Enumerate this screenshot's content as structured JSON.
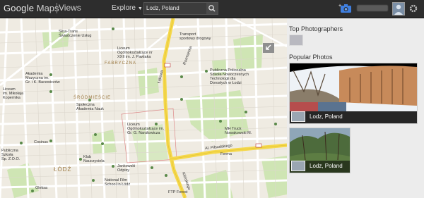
{
  "header": {
    "logo_google": "Google",
    "logo_maps": "Maps",
    "views": "Views",
    "explore": "Explore",
    "search_value": "Lodz, Poland"
  },
  "panel": {
    "top_photographers": "Top Photographers",
    "popular_photos": "Popular Photos",
    "photos": [
      {
        "caption": "Lodz, Poland"
      },
      {
        "caption": "Lodz, Poland"
      }
    ]
  },
  "map": {
    "labels": [
      "Skra-Trans",
      "Świadczenie Usług",
      "Transport",
      "sportowy drogowy",
      "Liceum",
      "Ogólnokształcące nr",
      "XXII im. J. Pawlaka",
      "Akademia",
      "Muzyczna im.",
      "Gr. i K. Bacewiczów",
      "Liceum",
      "im. Mikołaja",
      "Kopernika",
      "ŚRÓDMIEŚCIE",
      "Społeczna",
      "Akademia Nauk",
      "Publiczna Policealna",
      "Szkoła Nowoczesnych",
      "Technologii dla",
      "Dorosłych w Łodzi",
      "Liceum",
      "Ogólnokształcące im.",
      "Gr. G. Narutowicza",
      "MH Truck",
      "Nowakowski M.",
      "Cosinus",
      "Klub",
      "Nauczyciela",
      "Jankowski",
      "Odpisy",
      "National Film",
      "School in Łódź",
      "ŁÓDŹ",
      "FABRYCZNA",
      "Al. Piłsudskiego",
      "Ferma",
      "Publiczna",
      "Szkoła",
      "Sp. Z.O.O.",
      "Oleksa",
      "Rozmarska",
      "Łąkowa",
      "Kilińskiego",
      "FTP Forest"
    ]
  },
  "colors": {
    "topbar": "#2d2d2d",
    "road_yellow": "#f5d84b",
    "park_green": "#cfe5b4",
    "panel_bg": "#ececec"
  }
}
